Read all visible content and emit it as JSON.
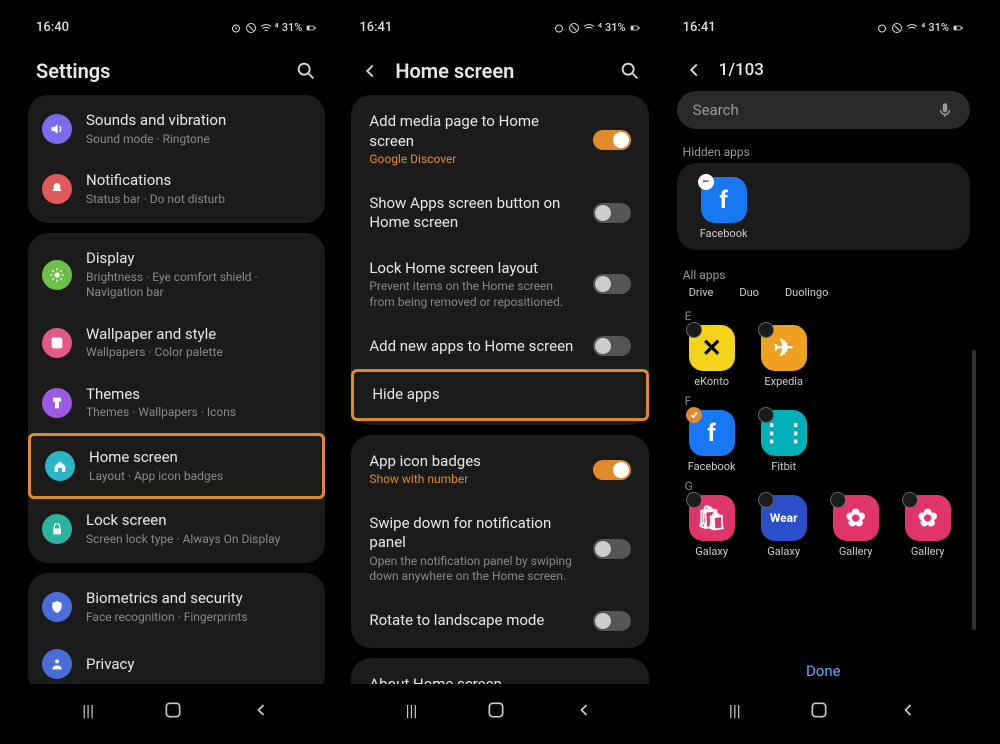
{
  "status": {
    "time1": "16:40",
    "time2": "16:41",
    "time3": "16:41",
    "battery": "31%"
  },
  "screen1": {
    "title": "Settings",
    "groups": [
      [
        {
          "icon": "volume",
          "color": "#7b6cf0",
          "title": "Sounds and vibration",
          "sub": "Sound mode · Ringtone"
        },
        {
          "icon": "bell",
          "color": "#e05a5a",
          "title": "Notifications",
          "sub": "Status bar · Do not disturb"
        }
      ],
      [
        {
          "icon": "sun",
          "color": "#6bbf4b",
          "title": "Display",
          "sub": "Brightness · Eye comfort shield · Navigation bar"
        },
        {
          "icon": "palette",
          "color": "#e05a8a",
          "title": "Wallpaper and style",
          "sub": "Wallpapers · Color palette"
        },
        {
          "icon": "brush",
          "color": "#9b5ae0",
          "title": "Themes",
          "sub": "Themes · Wallpapers · Icons"
        },
        {
          "icon": "home",
          "color": "#2bb5c9",
          "title": "Home screen",
          "sub": "Layout · App icon badges",
          "highlight": true
        },
        {
          "icon": "lock",
          "color": "#2bb5a0",
          "title": "Lock screen",
          "sub": "Screen lock type · Always On Display"
        }
      ],
      [
        {
          "icon": "shield",
          "color": "#4a6ed9",
          "title": "Biometrics and security",
          "sub": "Face recognition · Fingerprints"
        },
        {
          "icon": "privacy",
          "color": "#4a6ed9",
          "title": "Privacy",
          "sub": ""
        }
      ]
    ]
  },
  "screen2": {
    "title": "Home screen",
    "groups": [
      [
        {
          "title": "Add media page to Home screen",
          "sub": "Google Discover",
          "subOrange": true,
          "toggle": "on"
        },
        {
          "title": "Show Apps screen button on Home screen",
          "toggle": "off"
        },
        {
          "title": "Lock Home screen layout",
          "sub": "Prevent items on the Home screen from being removed or repositioned.",
          "toggle": "off"
        },
        {
          "title": "Add new apps to Home screen",
          "toggle": "off"
        },
        {
          "title": "Hide apps",
          "highlight": true
        }
      ],
      [
        {
          "title": "App icon badges",
          "sub": "Show with number",
          "subOrange": true,
          "toggle": "on"
        },
        {
          "title": "Swipe down for notification panel",
          "sub": "Open the notification panel by swiping down anywhere on the Home screen.",
          "toggle": "off"
        },
        {
          "title": "Rotate to landscape mode",
          "toggle": "off"
        }
      ],
      [
        {
          "title": "About Home screen"
        }
      ]
    ]
  },
  "screen3": {
    "counter": "1/103",
    "search_placeholder": "Search",
    "hidden_label": "Hidden apps",
    "hidden_apps": [
      {
        "name": "Facebook",
        "bg": "#1877f2",
        "glyph": "f",
        "badge": "remove"
      }
    ],
    "all_label": "All apps",
    "top_row": [
      "Drive",
      "Duo",
      "Duolingo"
    ],
    "sections": [
      {
        "letter": "E",
        "apps": [
          {
            "name": "eKonto",
            "bg": "#f2d51a",
            "glyph": "✕",
            "dark": true
          },
          {
            "name": "Expedia",
            "bg": "#f0a020",
            "glyph": "✈"
          }
        ]
      },
      {
        "letter": "F",
        "apps": [
          {
            "name": "Facebook",
            "bg": "#1877f2",
            "glyph": "f",
            "checked": true
          },
          {
            "name": "Fitbit",
            "bg": "#00b0b9",
            "glyph": "⋮⋮"
          }
        ]
      },
      {
        "letter": "G",
        "apps": [
          {
            "name": "Galaxy",
            "bg": "#e0356b",
            "glyph": "🛍"
          },
          {
            "name": "Galaxy",
            "bg": "#2b4fc9",
            "glyph": "Wear",
            "small": true
          },
          {
            "name": "Gallery",
            "bg": "#e0356b",
            "glyph": "✿"
          },
          {
            "name": "Gallery",
            "bg": "#e0356b",
            "glyph": "✿"
          }
        ]
      }
    ],
    "done": "Done"
  }
}
